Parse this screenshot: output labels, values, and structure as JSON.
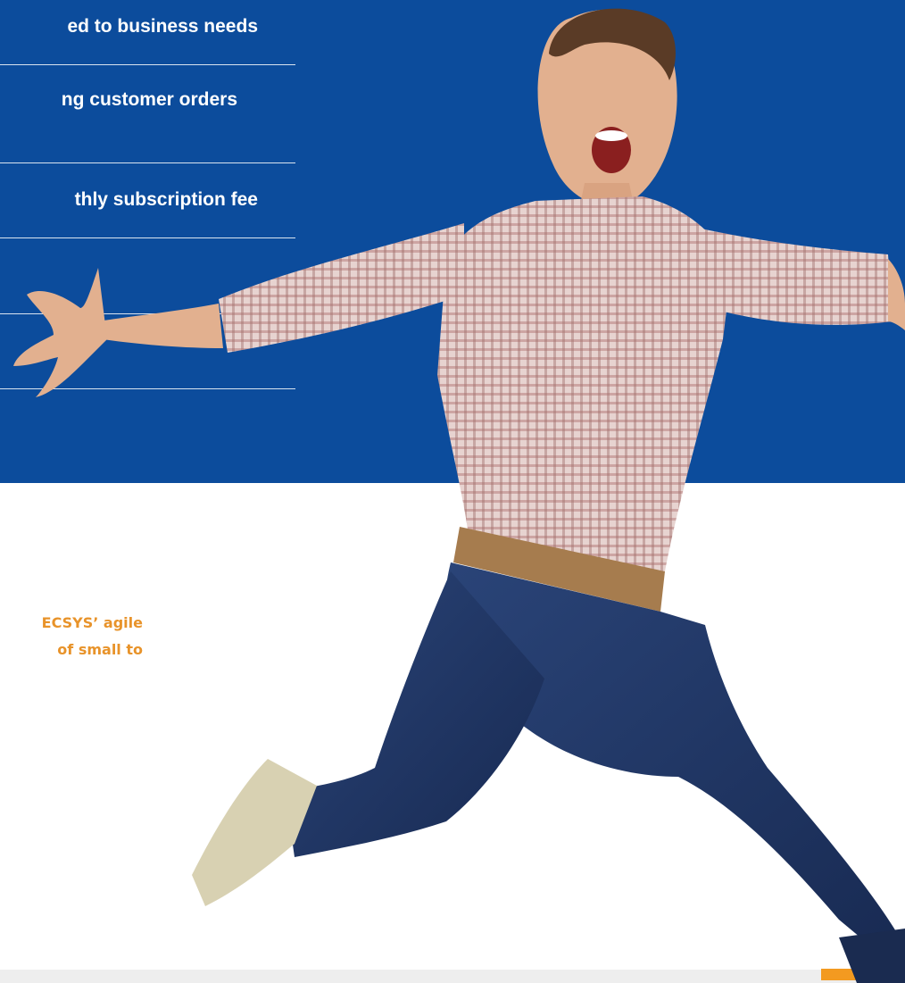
{
  "features": [
    {
      "text": "ed to business needs"
    },
    {
      "text": "ng customer orders"
    },
    {
      "text": "thly subscription fee"
    }
  ],
  "description": {
    "line1": "ECSYS’ agile",
    "line2": "of  small  to"
  },
  "colors": {
    "hero_blue": "#0c4c9c",
    "accent_orange": "#f39a20",
    "text_orange": "#e8932a",
    "shirt": "#c79a97",
    "jeans": "#1f3461",
    "skin": "#e2b08f"
  },
  "images": {
    "hero_person": "man-jumping-with-arms-outstretched"
  }
}
